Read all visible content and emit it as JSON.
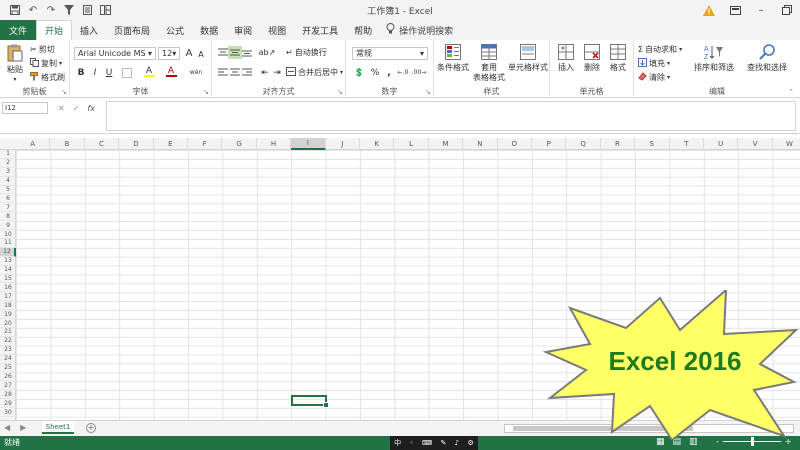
{
  "window": {
    "title": "工作簿1  -  Excel"
  },
  "quick_access": {
    "icons": [
      "save-icon",
      "undo-icon",
      "redo-icon",
      "filter-icon",
      "form-icon",
      "sort-icon"
    ]
  },
  "menu": {
    "file": "文件",
    "tabs": [
      "开始",
      "插入",
      "页面布局",
      "公式",
      "数据",
      "审阅",
      "视图",
      "开发工具",
      "帮助"
    ],
    "active_index": 0,
    "tell_me": "操作说明搜索"
  },
  "ribbon": {
    "clipboard": {
      "label": "剪贴板",
      "paste": "粘贴",
      "cut": "剪切",
      "copy": "复制",
      "format_painter": "格式刷"
    },
    "font": {
      "label": "字体",
      "family": "Arial Unicode MS",
      "size": "12",
      "grow": "A",
      "shrink": "A",
      "bold": "B",
      "italic": "I",
      "underline": "U",
      "fill_letter": "A",
      "color_letter": "A",
      "phonetic": "wén"
    },
    "alignment": {
      "label": "对齐方式",
      "wrap": "自动换行",
      "merge": "合并后居中"
    },
    "number": {
      "label": "数字",
      "format": "常规",
      "percent": "%",
      "comma": ","
    },
    "styles": {
      "label": "样式",
      "conditional": "条件格式",
      "table_line1": "套用",
      "table_line2": "表格格式",
      "cell_styles": "单元格样式"
    },
    "cells": {
      "label": "单元格",
      "insert": "插入",
      "delete": "删除",
      "format": "格式"
    },
    "editing": {
      "label": "编辑",
      "autosum": "自动求和",
      "fill": "填充",
      "clear": "清除",
      "sort_filter": "排序和筛选",
      "find_select": "查找和选择"
    }
  },
  "formula_bar": {
    "name_box": "I12",
    "fx": "fx",
    "value": ""
  },
  "grid": {
    "columns": [
      "A",
      "B",
      "C",
      "D",
      "E",
      "F",
      "G",
      "H",
      "I",
      "J",
      "K",
      "L",
      "M",
      "N",
      "O",
      "P",
      "Q",
      "R",
      "S",
      "T",
      "U",
      "V",
      "W"
    ],
    "rows": [
      "1",
      "2",
      "3",
      "4",
      "5",
      "6",
      "7",
      "8",
      "9",
      "10",
      "11",
      "12",
      "13",
      "14",
      "15",
      "16",
      "17",
      "18",
      "19",
      "20",
      "21",
      "22",
      "23",
      "24",
      "25",
      "26",
      "27",
      "28",
      "29",
      "30"
    ],
    "selected_column": "I",
    "selected_row": "12"
  },
  "sheets": {
    "tabs": [
      "Sheet1"
    ],
    "active": "Sheet1",
    "add": "+"
  },
  "status": {
    "ready": "就绪",
    "zoom_minus": "-",
    "zoom_plus": "+"
  },
  "callout": {
    "text": "Excel 2016"
  },
  "colors": {
    "accent": "#217346",
    "burst_fill": "#ffff66",
    "burst_text": "#1e7a1e"
  }
}
